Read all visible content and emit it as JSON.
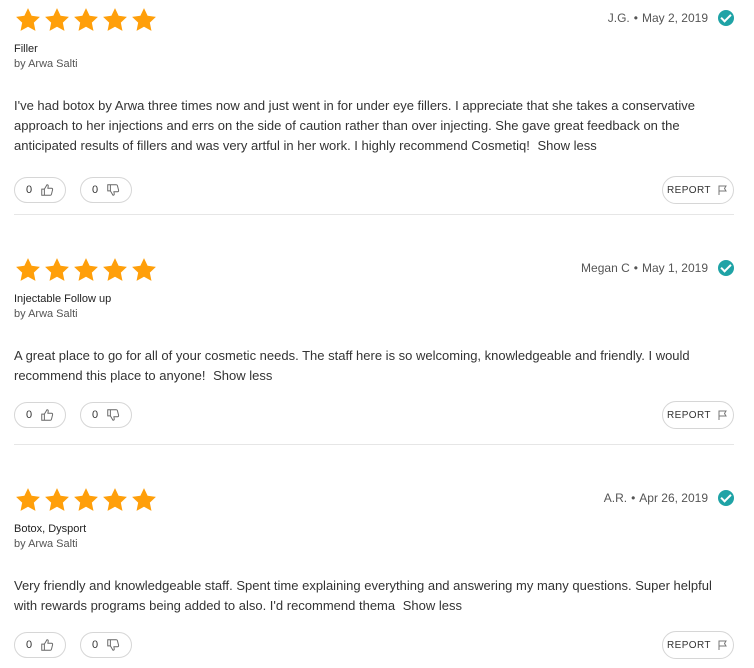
{
  "reviews": [
    {
      "rating": 5,
      "author": "J.G.",
      "date": "May 2, 2019",
      "title": "Filler",
      "by": "by Arwa Salti",
      "body": "I've had botox by Arwa three times now and just went in for under eye fillers. I appreciate that she takes a conservative approach to her injections and errs on the side of caution rather than over injecting. She gave great feedback on the anticipated results of fillers and was very artful in her work. I highly recommend Cosmetiq!",
      "show_less": "Show less",
      "helpful_count": "0",
      "unhelpful_count": "0",
      "report_label": "REPORT"
    },
    {
      "rating": 5,
      "author": "Megan C",
      "date": "May 1, 2019",
      "title": "Injectable Follow up",
      "by": "by Arwa Salti",
      "body": "A great place to go for all of your cosmetic needs. The staff here is so welcoming, knowledgeable and friendly. I would recommend this place to anyone!",
      "show_less": "Show less",
      "helpful_count": "0",
      "unhelpful_count": "0",
      "report_label": "REPORT"
    },
    {
      "rating": 5,
      "author": "A.R.",
      "date": "Apr 26, 2019",
      "title": "Botox, Dysport",
      "by": "by Arwa Salti",
      "body": "Very friendly and knowledgeable staff. Spent time explaining everything and answering my many questions. Super helpful with rewards programs being added to also. I'd recommend thema",
      "show_less": "Show less",
      "helpful_count": "0",
      "unhelpful_count": "0",
      "report_label": "REPORT"
    }
  ],
  "colors": {
    "star": "#ff9f0a",
    "verified": "#1fa3a6"
  },
  "icons": {
    "star": "star-icon",
    "verified": "verified-check-icon",
    "helpful": "thumbs-up-icon",
    "unhelpful": "thumbs-down-icon",
    "report": "flag-icon"
  }
}
